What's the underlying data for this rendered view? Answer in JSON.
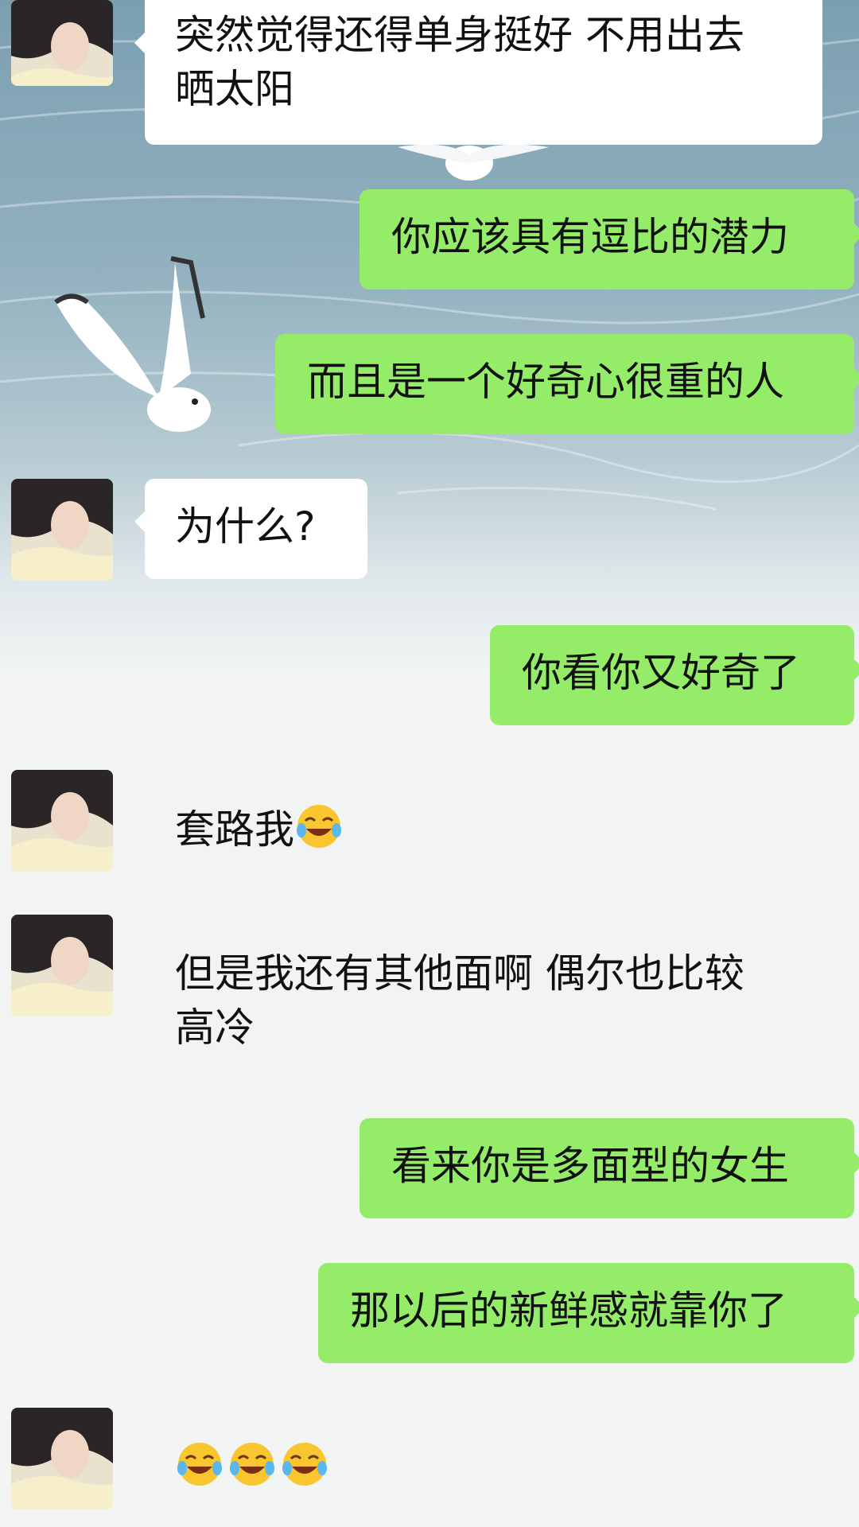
{
  "chat": {
    "messages": [
      {
        "sender": "other",
        "text": "突然觉得还得单身挺好 不用出去\n晒太阳"
      },
      {
        "sender": "self",
        "text": "你应该具有逗比的潜力"
      },
      {
        "sender": "self",
        "text": "而且是一个好奇心很重的人"
      },
      {
        "sender": "other",
        "text": "为什么?"
      },
      {
        "sender": "self",
        "text": "你看你又好奇了"
      },
      {
        "sender": "other",
        "text": "套路我",
        "emoji": "tears-of-joy-emoji"
      },
      {
        "sender": "other",
        "text": "但是我还有其他面啊 偶尔也比较\n高冷"
      },
      {
        "sender": "self",
        "text": "看来你是多面型的女生"
      },
      {
        "sender": "self",
        "text": "那以后的新鲜感就靠你了"
      },
      {
        "sender": "other",
        "emoji_only": [
          "tears-of-joy-emoji",
          "tears-of-joy-emoji",
          "tears-of-joy-emoji"
        ]
      }
    ]
  },
  "colors": {
    "self_bubble": "#95ec69",
    "other_bubble": "#ffffff",
    "chat_background": "#f3f4f4",
    "water_background": "#8fb0c0"
  },
  "icons": {
    "background": "seagull-water-wallpaper",
    "avatar": "contact-avatar-girl"
  }
}
